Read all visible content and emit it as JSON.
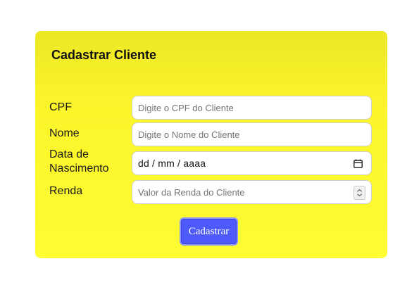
{
  "form": {
    "title": "Cadastrar Cliente",
    "fields": [
      {
        "label": "CPF",
        "placeholder": "Digite o CPF do Cliente",
        "value": ""
      },
      {
        "label": "Nome",
        "placeholder": "Digite o Nome do Cliente",
        "value": ""
      },
      {
        "label_line1": "Data de",
        "label_line2": "Nascimento",
        "value": "dd / mm / aaaa",
        "icon": "calendar-icon"
      },
      {
        "label": "Renda",
        "placeholder": "Valor da Renda do Cliente",
        "value": "",
        "icon": "spinner-icon"
      }
    ],
    "submit_label": "Cadastrar"
  },
  "colors": {
    "card_background": "#fdfd31",
    "button_background": "#4e5bfa",
    "button_text": "#ffffff"
  }
}
